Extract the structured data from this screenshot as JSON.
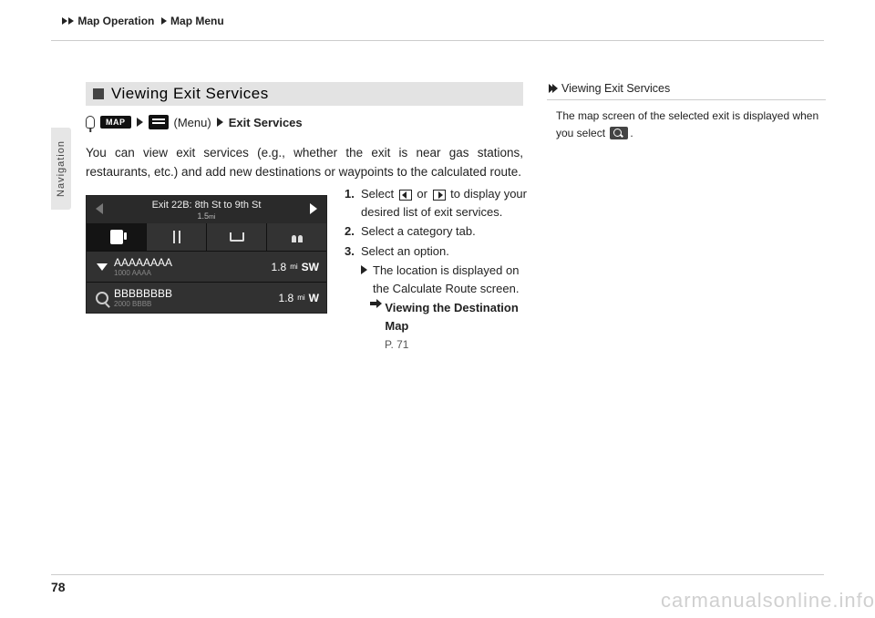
{
  "breadcrumb": {
    "a": "Map Operation",
    "b": "Map Menu"
  },
  "side_tab": "Navigation",
  "page_number": "78",
  "watermark": "carmanualsonline.info",
  "section": {
    "title": "Viewing Exit Services",
    "path_menu_word": "(Menu)",
    "path_map_btn": "MAP",
    "path_dest": "Exit Services",
    "body": "You can view exit services (e.g., whether the exit is near gas stations, restaurants, etc.) and add new destinations or waypoints to the calculated route."
  },
  "screenshot": {
    "title": "Exit 22B: 8th St to 9th St",
    "subtitle": "1.5",
    "rows": [
      {
        "name": "AAAAAAAA",
        "sub": "1000 AAAA",
        "dist": "1.8",
        "dir": "SW"
      },
      {
        "name": "BBBBBBBB",
        "sub": "2000 BBBB",
        "dist": "1.8",
        "dir": "W"
      }
    ]
  },
  "steps": {
    "s1a": "Select ",
    "s1b": " or ",
    "s1c": " to display your desired list of exit services.",
    "s2": "Select a category tab.",
    "s3": "Select an option.",
    "s3sub": "The location is displayed on the Calculate Route screen.",
    "link": "Viewing the Destination Map",
    "linkpage": "P. 71"
  },
  "tip": {
    "title": "Viewing Exit Services",
    "body_a": "The map screen of the selected exit is displayed when you select ",
    "body_b": "."
  }
}
